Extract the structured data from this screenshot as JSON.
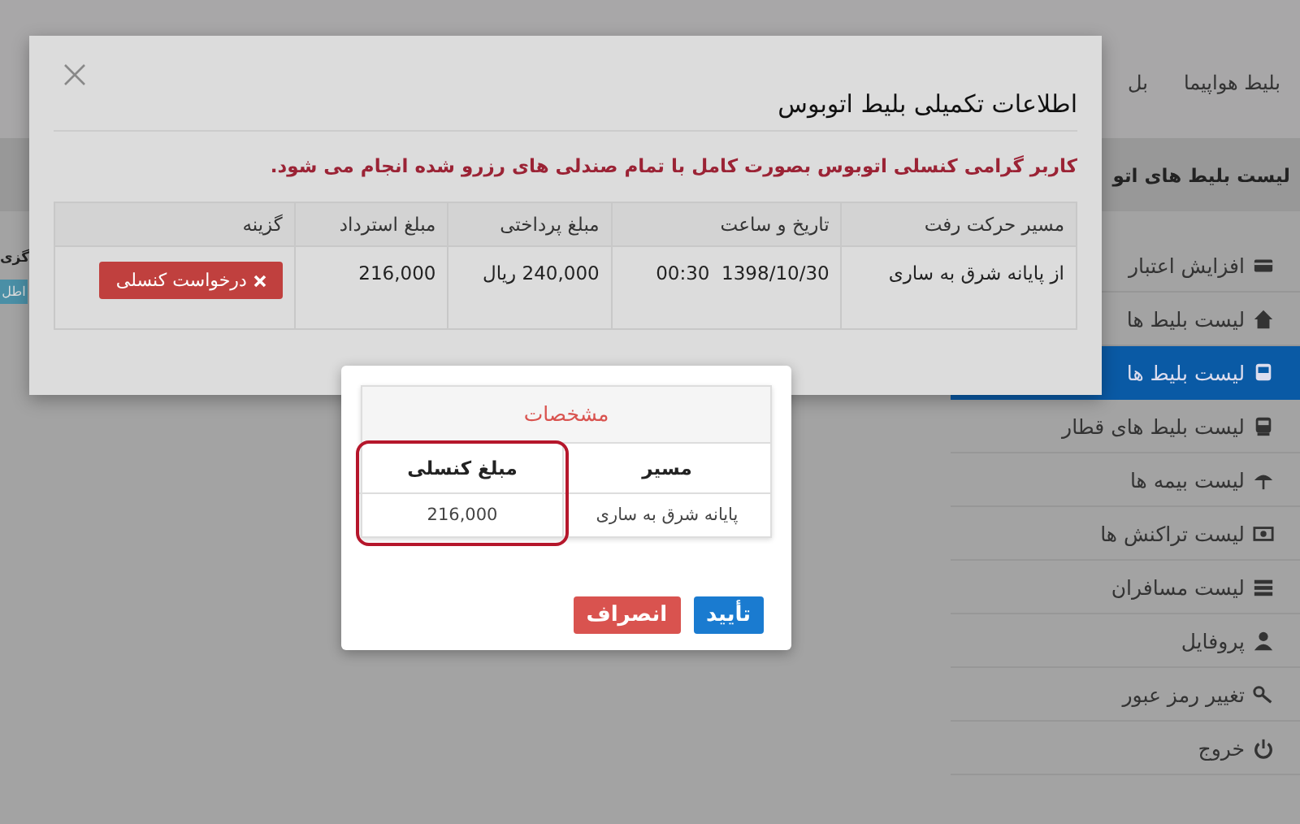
{
  "nav": {
    "items": [
      "بلیط هواپیما",
      "بل"
    ]
  },
  "page_header": "لیست بلیط های اتو",
  "left_panel": {
    "label": "گزی",
    "button": "اطل"
  },
  "sidebar": {
    "items": [
      {
        "label": "افزایش اعتبار",
        "selected": false
      },
      {
        "label": "لیست بلیط ها",
        "selected": false
      },
      {
        "label": "لیست بلیط ها",
        "selected": true
      },
      {
        "label": "لیست بلیط های قطار",
        "selected": false
      },
      {
        "label": "لیست بیمه ها",
        "selected": false
      },
      {
        "label": "لیست تراکنش ها",
        "selected": false
      },
      {
        "label": "لیست مسافران",
        "selected": false
      },
      {
        "label": "پروفایل",
        "selected": false
      },
      {
        "label": "تغییر رمز عبور",
        "selected": false
      },
      {
        "label": "خروج",
        "selected": false
      }
    ]
  },
  "details_modal": {
    "title": "اطلاعات تکمیلی بلیط اتوبوس",
    "notice": "کاربر گرامی کنسلی اتوبوس بصورت کامل با تمام صندلی های رزرو شده انجام می شود.",
    "table": {
      "columns": [
        "مسیر حرکت رفت",
        "تاریخ و ساعت",
        "مبلغ پرداختی",
        "مبلغ استرداد",
        "گزینه"
      ],
      "rows": [
        {
          "cells": [
            "از پایانه شرق به ساری",
            "1398/10/30  00:30",
            "240,000 ریال",
            "216,000"
          ],
          "action": "درخواست کنسلی"
        }
      ]
    }
  },
  "confirm_dialog": {
    "panel_title": "مشخصات",
    "columns": [
      {
        "label": "مسیر",
        "values": [
          "پایانه شرق به ساری"
        ],
        "highlighted": false
      },
      {
        "label": "مبلغ کنسلی",
        "values": [
          "216,000"
        ],
        "highlighted": true
      }
    ],
    "buttons": [
      {
        "label": "تأیید",
        "kind": "primary"
      },
      {
        "label": "انصراف",
        "kind": "danger"
      }
    ]
  }
}
